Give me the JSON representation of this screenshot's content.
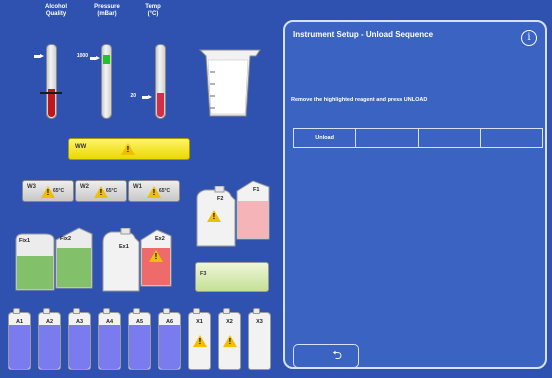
{
  "gauges": {
    "alcohol_label": "Alcohol\nQuality",
    "pressure_label": "Pressure\n(mBar)",
    "temp_label": "Temp\n(°C)",
    "pressure_value": "1000",
    "temp_value": "20"
  },
  "wax_bath": {
    "label": "WW"
  },
  "wax_units": [
    {
      "label": "W3",
      "temp": "65°C"
    },
    {
      "label": "W2",
      "temp": "65°C"
    },
    {
      "label": "W1",
      "temp": "65°C"
    }
  ],
  "fixative": [
    {
      "label": "Fix1"
    },
    {
      "label": "Fix2"
    }
  ],
  "exchange": [
    {
      "label": "Ex1"
    },
    {
      "label": "Ex2"
    }
  ],
  "flush": [
    {
      "label": "F2"
    },
    {
      "label": "F1"
    }
  ],
  "flush_bath": {
    "label": "F3"
  },
  "alcohol_bottles": [
    "A1",
    "A2",
    "A3",
    "A4",
    "A5",
    "A6",
    "X1",
    "X2",
    "X3"
  ],
  "panel": {
    "title": "Instrument Setup - Unload Sequence",
    "info_icon": "i",
    "message": "Remove the highlighted reagent and press UNLOAD",
    "sequence": [
      "Unload",
      "",
      "",
      ""
    ],
    "back_icon": "⮌"
  },
  "colors": {
    "background": "#2f52b0",
    "panel": "#3b63c2",
    "alcohol": "#7b7bf0",
    "waste": "#f08080",
    "fix_green": "#89c56b",
    "warning": "#f0c000"
  }
}
